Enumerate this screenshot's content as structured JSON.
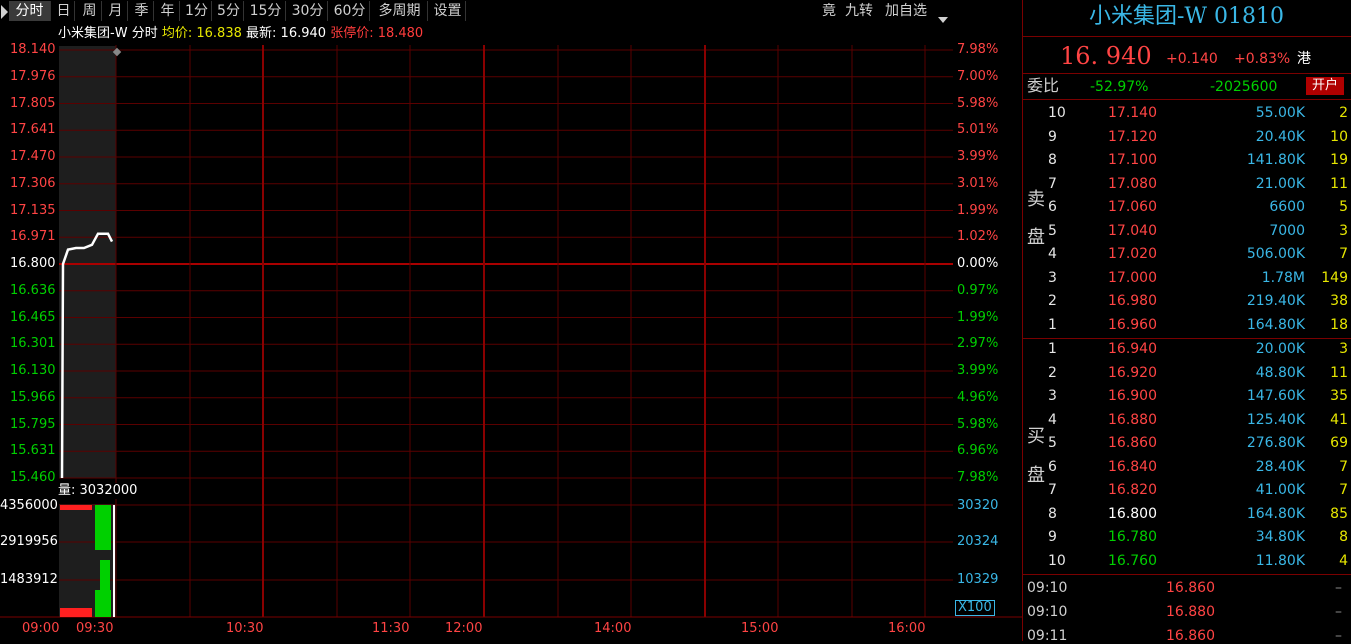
{
  "toolbar": {
    "tabs": [
      "分时",
      "日",
      "周",
      "月",
      "季",
      "年",
      "1分",
      "5分",
      "15分",
      "30分",
      "60分",
      "多周期",
      "设置"
    ],
    "right": [
      "竟",
      "九转",
      "加自选"
    ]
  },
  "title": {
    "name": "小米集团-W",
    "mode": "分时",
    "avg_label": "均价:",
    "avg_value": "16.838",
    "last_label": "最新:",
    "last_value": "16.940",
    "limit_label": "张停价:",
    "limit_value": "18.480"
  },
  "price_axis": {
    "left": [
      "18.140",
      "17.976",
      "17.805",
      "17.641",
      "17.470",
      "17.306",
      "17.135",
      "16.971",
      "16.800",
      "16.636",
      "16.465",
      "16.301",
      "16.130",
      "15.966",
      "15.795",
      "15.631",
      "15.460"
    ],
    "right": [
      "7.98%",
      "7.00%",
      "5.98%",
      "5.01%",
      "3.99%",
      "3.01%",
      "1.99%",
      "1.02%",
      "0.00%",
      "0.97%",
      "1.99%",
      "2.97%",
      "3.99%",
      "4.96%",
      "5.98%",
      "6.96%",
      "7.98%"
    ]
  },
  "volume": {
    "label": "量: 3032000",
    "left": [
      "4356000",
      "2919956",
      "1483912"
    ],
    "right": [
      "30320",
      "20324",
      "10329"
    ],
    "multiplier": "X100"
  },
  "time_axis": [
    "09:00",
    "09:30",
    "10:30",
    "11:30",
    "12:00",
    "14:00",
    "15:00",
    "16:00"
  ],
  "chart_data": {
    "type": "line",
    "series": [
      {
        "x": [
          "09:00",
          "09:01",
          "09:05",
          "09:10",
          "09:15",
          "09:20",
          "09:25",
          "09:27",
          "09:30"
        ],
        "values": [
          15.46,
          16.8,
          16.89,
          16.9,
          16.9,
          16.92,
          16.99,
          16.99,
          16.94
        ]
      }
    ],
    "ylim": [
      15.46,
      18.14
    ]
  },
  "stock": {
    "title": "小米集团-W 01810",
    "price": "16. 940",
    "change": "+0.140",
    "change_pct": "+0.83%",
    "market": "港"
  },
  "ratio": {
    "label": "委比",
    "pct": "-52.97%",
    "diff": "-2025600",
    "open_btn": "开户"
  },
  "sell_label": [
    "卖",
    "盘"
  ],
  "buy_label": [
    "买",
    "盘"
  ],
  "asks": [
    {
      "lvl": "10",
      "price": "17.140",
      "vol": "55.00K",
      "n": "2"
    },
    {
      "lvl": "9",
      "price": "17.120",
      "vol": "20.40K",
      "n": "10"
    },
    {
      "lvl": "8",
      "price": "17.100",
      "vol": "141.80K",
      "n": "19"
    },
    {
      "lvl": "7",
      "price": "17.080",
      "vol": "21.00K",
      "n": "11"
    },
    {
      "lvl": "6",
      "price": "17.060",
      "vol": "6600",
      "n": "5"
    },
    {
      "lvl": "5",
      "price": "17.040",
      "vol": "7000",
      "n": "3"
    },
    {
      "lvl": "4",
      "price": "17.020",
      "vol": "506.00K",
      "n": "7"
    },
    {
      "lvl": "3",
      "price": "17.000",
      "vol": "1.78M",
      "n": "149"
    },
    {
      "lvl": "2",
      "price": "16.980",
      "vol": "219.40K",
      "n": "38"
    },
    {
      "lvl": "1",
      "price": "16.960",
      "vol": "164.80K",
      "n": "18"
    }
  ],
  "bids": [
    {
      "lvl": "1",
      "price": "16.940",
      "vol": "20.00K",
      "n": "3",
      "color": "#ff4444"
    },
    {
      "lvl": "2",
      "price": "16.920",
      "vol": "48.80K",
      "n": "11",
      "color": "#ff4444"
    },
    {
      "lvl": "3",
      "price": "16.900",
      "vol": "147.60K",
      "n": "35",
      "color": "#ff4444"
    },
    {
      "lvl": "4",
      "price": "16.880",
      "vol": "125.40K",
      "n": "41",
      "color": "#ff4444"
    },
    {
      "lvl": "5",
      "price": "16.860",
      "vol": "276.80K",
      "n": "69",
      "color": "#ff4444"
    },
    {
      "lvl": "6",
      "price": "16.840",
      "vol": "28.40K",
      "n": "7",
      "color": "#ff4444"
    },
    {
      "lvl": "7",
      "price": "16.820",
      "vol": "41.00K",
      "n": "7",
      "color": "#ff4444"
    },
    {
      "lvl": "8",
      "price": "16.800",
      "vol": "164.80K",
      "n": "85",
      "color": "#ffffff"
    },
    {
      "lvl": "9",
      "price": "16.780",
      "vol": "34.80K",
      "n": "8",
      "color": "#00d000"
    },
    {
      "lvl": "10",
      "price": "16.760",
      "vol": "11.80K",
      "n": "4",
      "color": "#00d000"
    }
  ],
  "ticks": [
    {
      "time": "09:10",
      "price": "16.860",
      "mark": "–"
    },
    {
      "time": "09:10",
      "price": "16.880",
      "mark": "–"
    },
    {
      "time": "09:11",
      "price": "16.860",
      "mark": "–"
    }
  ]
}
